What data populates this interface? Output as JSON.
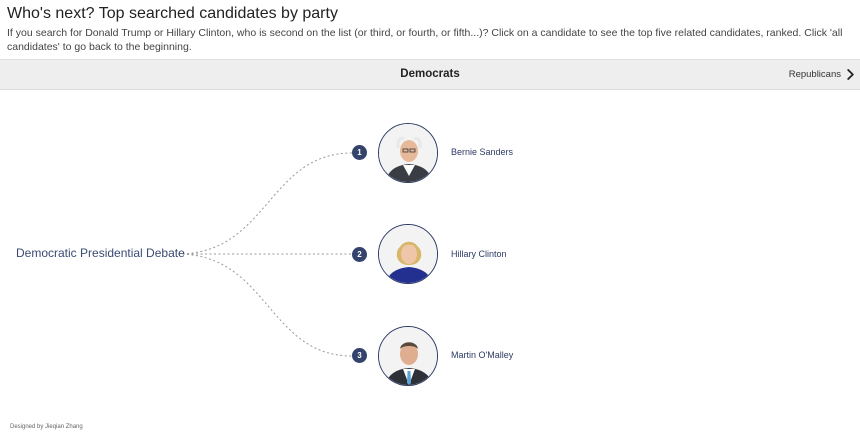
{
  "header": {
    "title": "Who's next? Top searched candidates by party",
    "description": "If you search for Donald Trump or Hillary Clinton, who is second on the list (or third, or fourth, or fifth...)? Click on a candidate to see the top five related candidates, ranked. Click 'all candidates' to go back to the beginning."
  },
  "tabs": {
    "active_label": "Democrats",
    "next_label": "Republicans",
    "next_icon": "chevron-right-icon"
  },
  "tree": {
    "root_label": "Democratic Presidential Debate",
    "candidates": [
      {
        "rank": "1",
        "name": "Bernie Sanders",
        "icon": "bernie-sanders-portrait"
      },
      {
        "rank": "2",
        "name": "Hillary Clinton",
        "icon": "hillary-clinton-portrait"
      },
      {
        "rank": "3",
        "name": "Martin O'Malley",
        "icon": "martin-omalley-portrait"
      }
    ]
  },
  "footer": {
    "credit": "Designed by Jieqian Zhang"
  },
  "colors": {
    "accent": "#34436b",
    "root_text": "#3b4a73",
    "link_line": "#999999",
    "tabbar_bg": "#eeeeee"
  }
}
